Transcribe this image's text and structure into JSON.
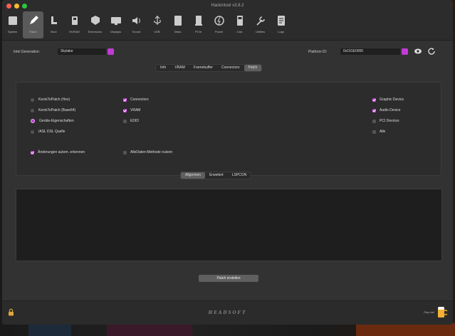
{
  "window": {
    "title": "Hackintool v3.8.2"
  },
  "toolbar": [
    {
      "label": "System",
      "icon": "system-icon"
    },
    {
      "label": "Patch",
      "icon": "pencil-icon",
      "selected": true
    },
    {
      "label": "Boot",
      "icon": "boot-icon"
    },
    {
      "label": "NVRAM",
      "icon": "nvram-icon"
    },
    {
      "label": "Extensions",
      "icon": "extensions-icon"
    },
    {
      "label": "Displays",
      "icon": "display-icon"
    },
    {
      "label": "Sound",
      "icon": "speaker-icon"
    },
    {
      "label": "USB",
      "icon": "usb-icon"
    },
    {
      "label": "Disks",
      "icon": "disk-icon"
    },
    {
      "label": "PCIe",
      "icon": "pcie-icon"
    },
    {
      "label": "Power",
      "icon": "power-icon"
    },
    {
      "label": "Calc",
      "icon": "calculator-icon"
    },
    {
      "label": "Utilities",
      "icon": "wrench-icon"
    },
    {
      "label": "Logs",
      "icon": "logs-icon"
    }
  ],
  "header": {
    "intel_generation_label": "Intel Generation:",
    "intel_generation_value": "Skylake",
    "platform_id_label": "Platform ID:",
    "platform_id_value": "0x191E0000"
  },
  "tabs": [
    {
      "label": "Info"
    },
    {
      "label": "VRAM"
    },
    {
      "label": "Framebuffer"
    },
    {
      "label": "Connectors"
    },
    {
      "label": "Patch",
      "selected": true
    }
  ],
  "options": {
    "radios": [
      {
        "label": "KextsToPatch (Hex)",
        "checked": false
      },
      {
        "label": "KextsToPatch (Base64)",
        "checked": false
      },
      {
        "label": "Geräte-Eigenschaften",
        "checked": true
      },
      {
        "label": "IASL DSL Quelle",
        "checked": false
      }
    ],
    "middle_checks": [
      {
        "label": "Connectors",
        "checked": true
      },
      {
        "label": "VRAM",
        "checked": true
      },
      {
        "label": "EDID",
        "checked": false
      }
    ],
    "right_checks": [
      {
        "label": "Graphic Device",
        "checked": true
      },
      {
        "label": "Audio Device",
        "checked": true
      },
      {
        "label": "PCI Devices",
        "checked": false
      },
      {
        "label": "Alle",
        "checked": false
      }
    ],
    "auto_detect_label": "Änderungen autom. erkennen",
    "all_data_label": "AlleDaten-Methode nutzen"
  },
  "subtabs": [
    {
      "label": "Allgemein",
      "selected": true
    },
    {
      "label": "Erweitert"
    },
    {
      "label": "LSPCON"
    }
  ],
  "generate_button": "Patch erstellen",
  "footer": {
    "logo": "HEADSOFT",
    "donate": "Pay me!"
  },
  "colors": {
    "accent": "#c13bd6",
    "window_bg": "#323232",
    "panel_bg": "#2c2c2c"
  }
}
